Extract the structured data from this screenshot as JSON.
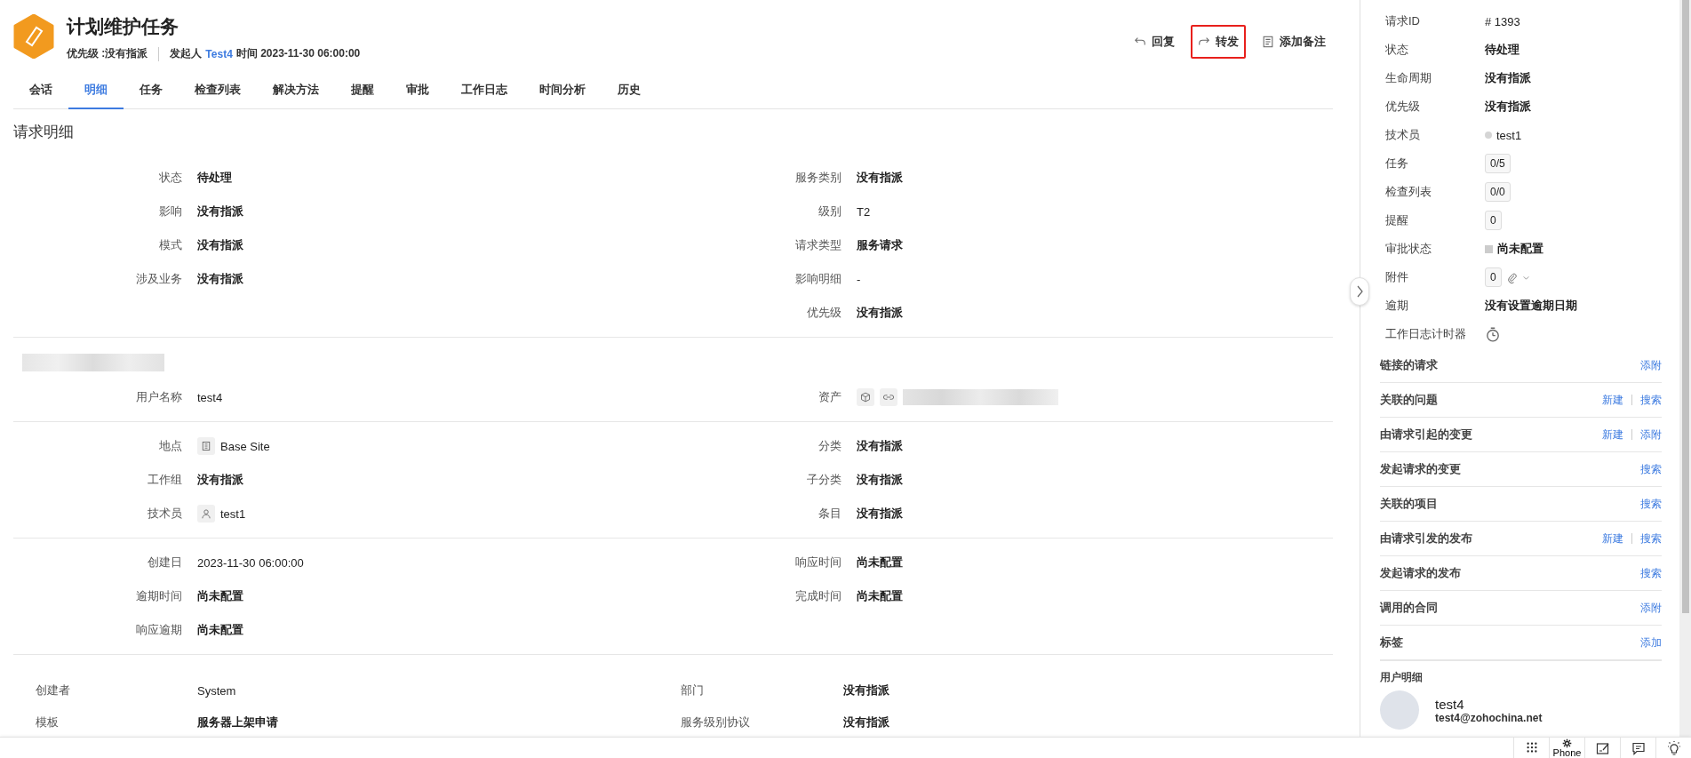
{
  "header": {
    "title": "计划维护任务",
    "priority": "优先级 :没有指派",
    "requester_label": "发起人",
    "requester": "Test4",
    "time_label": "时间",
    "time": "2023-11-30 06:00:00"
  },
  "actions": [
    {
      "kind": "reply",
      "label": "回复",
      "highlighted": false
    },
    {
      "kind": "forward",
      "label": "转发",
      "highlighted": true
    },
    {
      "kind": "note",
      "label": "添加备注",
      "highlighted": false
    }
  ],
  "tabs": [
    {
      "label": "会话",
      "selected": false
    },
    {
      "label": "明细",
      "selected": true
    },
    {
      "label": "任务",
      "selected": false
    },
    {
      "label": "检查列表",
      "selected": false
    },
    {
      "label": "解决方法",
      "selected": false
    },
    {
      "label": "提醒",
      "selected": false
    },
    {
      "label": "审批",
      "selected": false
    },
    {
      "label": "工作日志",
      "selected": false
    },
    {
      "label": "时间分析",
      "selected": false
    },
    {
      "label": "历史",
      "selected": false
    }
  ],
  "section_title": "请求明细",
  "detail_groups": [
    {
      "redacted_heading": false,
      "left": [
        {
          "label": "状态",
          "value": "待处理",
          "kind": "bold"
        },
        {
          "label": "影响",
          "value": "没有指派",
          "kind": "bold"
        },
        {
          "label": "模式",
          "value": "没有指派",
          "kind": "bold"
        },
        {
          "label": "涉及业务",
          "value": "没有指派",
          "kind": "bold"
        }
      ],
      "right": [
        {
          "label": "服务类别",
          "value": "没有指派",
          "kind": "bold"
        },
        {
          "label": "级别",
          "value": "T2",
          "kind": "plain"
        },
        {
          "label": "请求类型",
          "value": "服务请求",
          "kind": "bold"
        },
        {
          "label": "影响明细",
          "value": "-",
          "kind": "plain"
        },
        {
          "label": "优先级",
          "value": "没有指派",
          "kind": "bold"
        }
      ]
    },
    {
      "redacted_heading": true,
      "left": [
        {
          "label": "用户名称",
          "value": "test4",
          "kind": "plain"
        }
      ],
      "right": [
        {
          "label": "资产",
          "kind": "asset"
        }
      ]
    },
    {
      "redacted_heading": false,
      "left": [
        {
          "label": "地点",
          "value": "Base Site",
          "kind": "site"
        },
        {
          "label": "工作组",
          "value": "没有指派",
          "kind": "bold"
        },
        {
          "label": "技术员",
          "value": "test1",
          "kind": "person"
        }
      ],
      "right": [
        {
          "label": "分类",
          "value": "没有指派",
          "kind": "bold"
        },
        {
          "label": "子分类",
          "value": "没有指派",
          "kind": "bold"
        },
        {
          "label": "条目",
          "value": "没有指派",
          "kind": "bold"
        }
      ]
    },
    {
      "redacted_heading": false,
      "left": [
        {
          "label": "创建日",
          "value": "2023-11-30 06:00:00",
          "kind": "plain"
        },
        {
          "label": "逾期时间",
          "value": "尚未配置",
          "kind": "bold"
        },
        {
          "label": "响应逾期",
          "value": "尚未配置",
          "kind": "bold"
        }
      ],
      "right": [
        {
          "label": "响应时间",
          "value": "尚未配置",
          "kind": "bold"
        },
        {
          "label": "完成时间",
          "value": "尚未配置",
          "kind": "bold"
        }
      ]
    }
  ],
  "extra_fields": [
    {
      "label": "创建者",
      "value": "System",
      "bold": false,
      "label_2": "部门",
      "value_2": "没有指派"
    },
    {
      "label": "模板",
      "value": "服务器上架申请",
      "bold": true,
      "label_2": "服务级别协议",
      "value_2": "没有指派"
    }
  ],
  "sidebar": {
    "properties": [
      {
        "label": "请求ID",
        "value": "# 1393",
        "kind": "plain"
      },
      {
        "label": "状态",
        "value": "待处理",
        "kind": "bold"
      },
      {
        "label": "生命周期",
        "value": "没有指派",
        "kind": "bold"
      },
      {
        "label": "优先级",
        "value": "没有指派",
        "kind": "bold"
      },
      {
        "label": "技术员",
        "value": "test1",
        "kind": "technician"
      },
      {
        "label": "任务",
        "value": "0/5",
        "kind": "count"
      },
      {
        "label": "检查列表",
        "value": "0/0",
        "kind": "count"
      },
      {
        "label": "提醒",
        "value": "0",
        "kind": "count"
      },
      {
        "label": "审批状态",
        "value": "尚未配置",
        "kind": "approval"
      },
      {
        "label": "附件",
        "value": "0",
        "kind": "attachment"
      },
      {
        "label": "逾期",
        "value": "没有设置逾期日期",
        "kind": "bold"
      },
      {
        "label": "工作日志计时器",
        "kind": "timer"
      }
    ],
    "sections": [
      {
        "title": "链接的请求",
        "links": [
          "添附"
        ]
      },
      {
        "title": "关联的问题",
        "links": [
          "新建",
          "搜索"
        ]
      },
      {
        "title": "由请求引起的变更",
        "links": [
          "新建",
          "添附"
        ]
      },
      {
        "title": "发起请求的变更",
        "links": [
          "搜索"
        ]
      },
      {
        "title": "关联的项目",
        "links": [
          "搜索"
        ]
      },
      {
        "title": "由请求引发的发布",
        "links": [
          "新建",
          "搜索"
        ]
      },
      {
        "title": "发起请求的发布",
        "links": [
          "搜索"
        ]
      },
      {
        "title": "调用的合同",
        "links": [
          "添附"
        ]
      },
      {
        "title": "标签",
        "links": [
          "添加"
        ]
      }
    ],
    "user_details": {
      "title": "用户明细",
      "name": "test4",
      "email": "test4@zohochina.net"
    }
  },
  "bottom_bar": [
    {
      "kind": "dialpad"
    },
    {
      "kind": "phone",
      "label": "Phone"
    },
    {
      "kind": "compose"
    },
    {
      "kind": "chat"
    },
    {
      "kind": "bulb"
    }
  ]
}
